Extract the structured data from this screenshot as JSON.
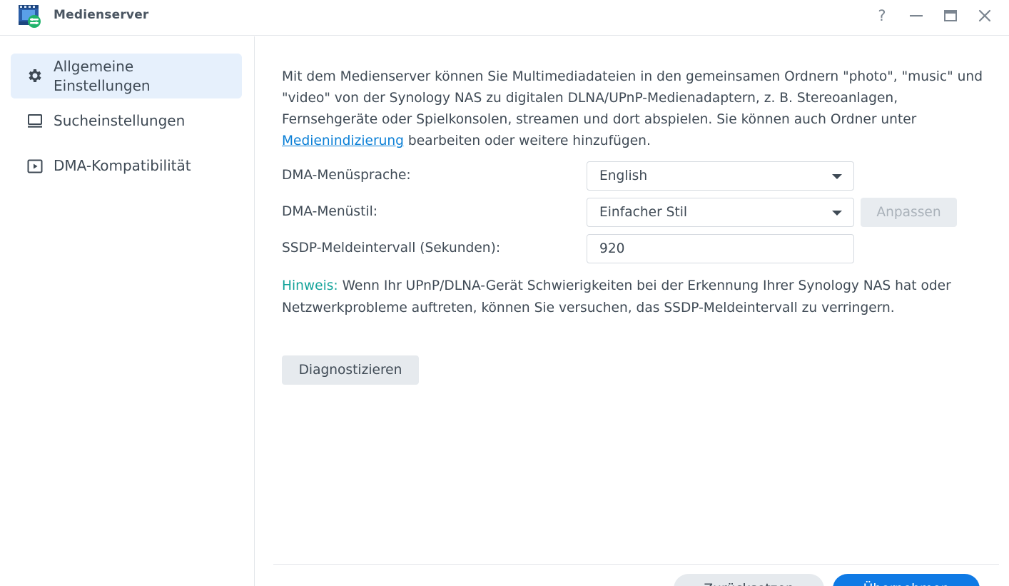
{
  "window": {
    "title": "Medienserver",
    "help_glyph": "?",
    "icon": "media-server-icon"
  },
  "sidebar": {
    "items": [
      {
        "label": "Allgemeine Einstellungen",
        "icon": "gear-icon",
        "active": true
      },
      {
        "label": "Sucheinstellungen",
        "icon": "monitor-icon",
        "active": false
      },
      {
        "label": "DMA-Kompatibilität",
        "icon": "play-box-icon",
        "active": false
      }
    ]
  },
  "main": {
    "intro_before_link": "Mit dem Medienserver können Sie Multimediadateien in den gemeinsamen Ordnern \"photo\", \"music\" und \"video\" von der Synology NAS zu digitalen DLNA/UPnP-Medienadaptern, z. B. Stereoanlagen, Fernsehgeräte oder Spielkonsolen, streamen und dort abspielen. Sie können auch Ordner unter ",
    "intro_link": "Medienindizierung",
    "intro_after_link": " bearbeiten oder weitere hinzufügen.",
    "menu_language_label": "DMA-Menüsprache:",
    "menu_language_value": "English",
    "menu_style_label": "DMA-Menüstil:",
    "menu_style_value": "Einfacher Stil",
    "customize_label": "Anpassen",
    "ssdp_label": "SSDP-Meldeintervall (Sekunden):",
    "ssdp_value": "920",
    "hint_label": "Hinweis:",
    "hint_text": " Wenn Ihr UPnP/DLNA-Gerät Schwierigkeiten bei der Erkennung Ihrer Synology NAS hat oder Netzwerkprobleme auftreten, können Sie versuchen, das SSDP-Meldeintervall zu verringern.",
    "diagnose_label": "Diagnostizieren"
  },
  "footer": {
    "reset_label": "Zurücksetzen",
    "apply_label": "Übernehmen"
  },
  "colors": {
    "accent": "#0f7ae5",
    "link": "#0a7fd6",
    "hint": "#13a39a",
    "active_bg": "#e6f0fc"
  }
}
